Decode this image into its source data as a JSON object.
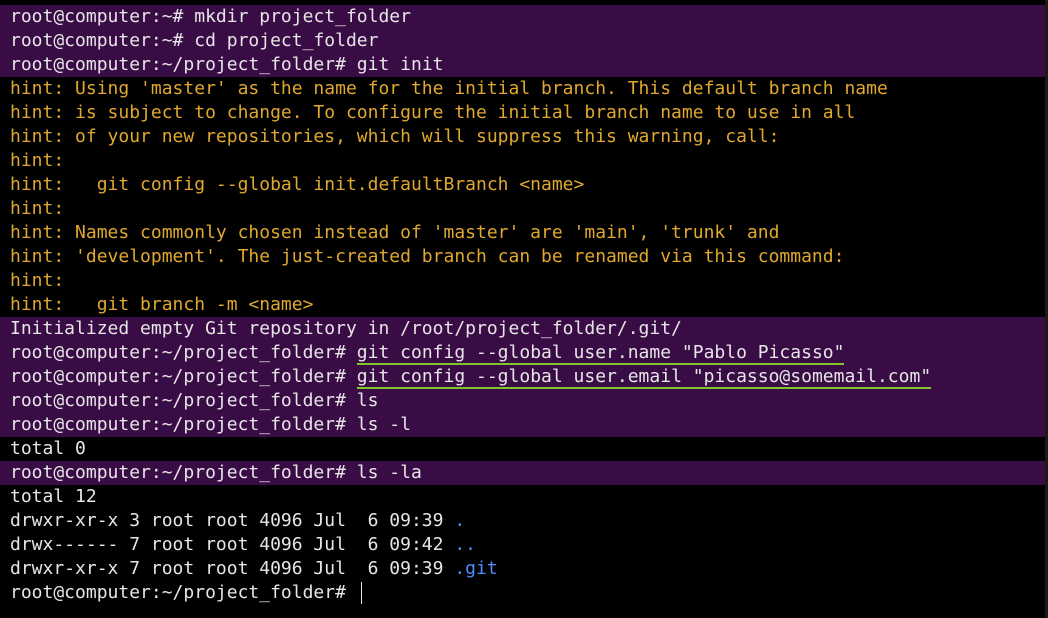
{
  "prompt_home": "root@computer:~#",
  "prompt_proj": "root@computer:~/project_folder#",
  "cmds": {
    "mkdir": "mkdir project_folder",
    "cd": "cd project_folder",
    "init": "git init",
    "config_name": "git config --global user.name \"Pablo Picasso\"",
    "config_email": "git config --global user.email \"picasso@somemail.com\"",
    "ls": "ls",
    "ls_l": "ls -l",
    "ls_la": "ls -la"
  },
  "hints": [
    "hint: Using 'master' as the name for the initial branch. This default branch name",
    "hint: is subject to change. To configure the initial branch name to use in all",
    "hint: of your new repositories, which will suppress this warning, call:",
    "hint:",
    "hint:   git config --global init.defaultBranch <name>",
    "hint:",
    "hint: Names commonly chosen instead of 'master' are 'main', 'trunk' and",
    "hint: 'development'. The just-created branch can be renamed via this command:",
    "hint:",
    "hint:   git branch -m <name>"
  ],
  "init_output": "Initialized empty Git repository in /root/project_folder/.git/",
  "total_0": "total 0",
  "total_12": "total 12",
  "listing": [
    {
      "perm": "drwxr-xr-x 3 root root 4096 Jul  6 09:39 ",
      "name": "."
    },
    {
      "perm": "drwx------ 7 root root 4096 Jul  6 09:42 ",
      "name": ".."
    },
    {
      "perm": "drwxr-xr-x 7 root root 4096 Jul  6 09:39 ",
      "name": ".git"
    }
  ],
  "colors": {
    "prompt_bg": "#3a0c46",
    "hint": "#e0a82e",
    "dir": "#4f8cff",
    "underline": "#7fc62b"
  }
}
